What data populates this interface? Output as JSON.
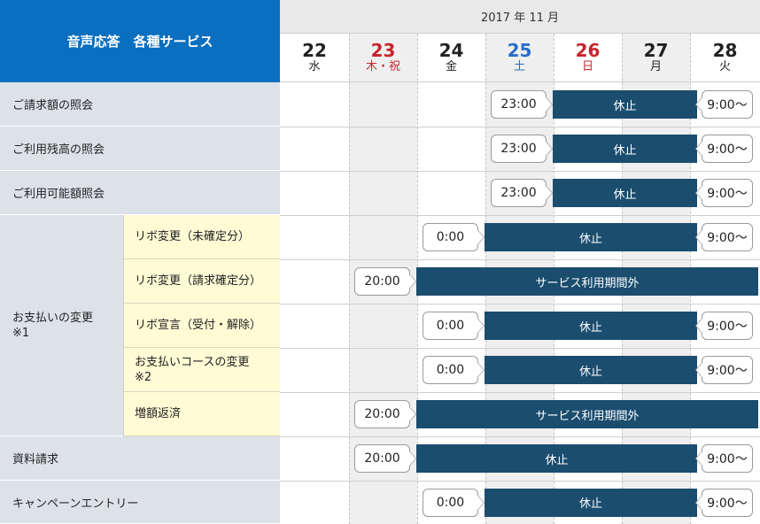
{
  "header": {
    "service_title": "音声応答　各種サービス",
    "month": "2017 年 11 月"
  },
  "days": [
    {
      "num": "22",
      "name": "水",
      "color": "#222222"
    },
    {
      "num": "23",
      "name": "木・祝",
      "color": "#c8242c"
    },
    {
      "num": "24",
      "name": "金",
      "color": "#222222"
    },
    {
      "num": "25",
      "name": "土",
      "color": "#2a6cc8"
    },
    {
      "num": "26",
      "name": "日",
      "color": "#c8242c"
    },
    {
      "num": "27",
      "name": "月",
      "color": "#222222"
    },
    {
      "num": "28",
      "name": "火",
      "color": "#222222"
    }
  ],
  "group_label": "お支払いの変更\n※1",
  "rows": [
    {
      "label": "ご請求額の照会",
      "start": "23:00",
      "bar": "休止",
      "resume": "9:00～"
    },
    {
      "label": "ご利用残高の照会",
      "start": "23:00",
      "bar": "休止",
      "resume": "9:00～"
    },
    {
      "label": "ご利用可能額照会",
      "start": "23:00",
      "bar": "休止",
      "resume": "9:00～"
    },
    {
      "label": "リボ変更（未確定分）",
      "start": "0:00",
      "bar": "休止",
      "resume": "9:00～"
    },
    {
      "label": "リボ変更（請求確定分）",
      "start": "20:00",
      "bar": "サービス利用期間外",
      "resume": ""
    },
    {
      "label": "リボ宣言（受付・解除）",
      "start": "0:00",
      "bar": "休止",
      "resume": "9:00～"
    },
    {
      "label": "お支払いコースの変更\n※2",
      "start": "0:00",
      "bar": "休止",
      "resume": "9:00～"
    },
    {
      "label": "増額返済",
      "start": "20:00",
      "bar": "サービス利用期間外",
      "resume": ""
    },
    {
      "label": "資料請求",
      "start": "20:00",
      "bar": "休止",
      "resume": "9:00～"
    },
    {
      "label": "キャンペーンエントリー",
      "start": "0:00",
      "bar": "休止",
      "resume": "9:00～"
    }
  ],
  "colors": {
    "header_blue": "#0a6fc0",
    "bar_navy": "#1b4d6f",
    "label_gray": "#dde2e8",
    "sub_yellow": "#fffbd5",
    "holiday_col": "#efefef"
  }
}
